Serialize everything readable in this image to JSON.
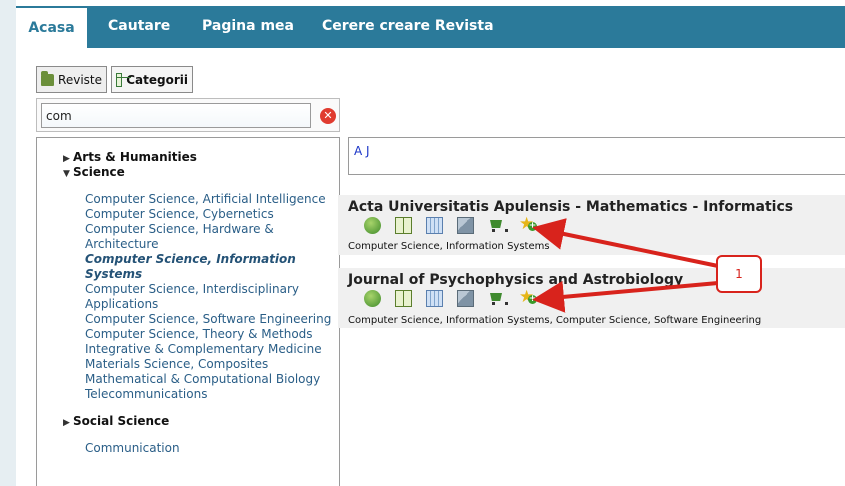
{
  "nav": {
    "tabs": [
      "Acasa",
      "Cautare",
      "Pagina mea",
      "Cerere creare Revista"
    ],
    "active": "Acasa"
  },
  "toolbar": {
    "reviste_label": "Reviste",
    "categorii_label": "Categorii"
  },
  "search": {
    "value": "com",
    "clear_icon": "clear-icon"
  },
  "tree": {
    "arts": "Arts & Humanities",
    "science": "Science",
    "social": "Social Science",
    "science_items": [
      "Computer Science, Artificial Intelligence",
      "Computer Science, Cybernetics",
      "Computer Science, Hardware &",
      "Architecture",
      "Computer Science, Information",
      "Systems",
      "Computer Science, Interdisciplinary",
      "Applications",
      "Computer Science, Software Engineering",
      "Computer Science, Theory & Methods",
      "Integrative & Complementary Medicine",
      "Materials Science, Composites",
      "Mathematical & Computational Biology",
      "Telecommunications"
    ],
    "social_items": [
      "Communication"
    ]
  },
  "letters": [
    "A",
    "J"
  ],
  "journals": [
    {
      "title": "Acta Universitatis Apulensis - Mathematics - Informatics",
      "categories": "Computer Science, Information Systems"
    },
    {
      "title": "Journal of Psychophysics and Astrobiology",
      "categories": "Computer Science, Information Systems, Computer Science, Software Engineering"
    }
  ],
  "annotation": {
    "label": "1",
    "color": "#d8231c"
  },
  "colors": {
    "nav": "#2b7a9a",
    "link": "#2a5e87",
    "letter": "#1a34c7"
  },
  "action_icons": [
    "globe-icon",
    "book-icon",
    "table-icon",
    "stack-icon",
    "cart-icon",
    "star-add-icon"
  ]
}
